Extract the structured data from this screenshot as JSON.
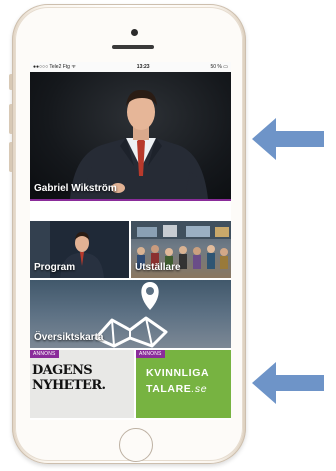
{
  "status_bar": {
    "carrier": "●●○○○ Tele2 Ftg ᯤ",
    "time": "13:23",
    "battery": "50 % ▭"
  },
  "hero": {
    "label": "Gabriel Wikström"
  },
  "tiles": {
    "program": "Program",
    "utstallare": "Utställare",
    "karta": "Översiktskarta"
  },
  "ads": {
    "tag": "ANNONS",
    "dn_line1": "DAGENS",
    "dn_line2": "NYHETER.",
    "kt_line1": "KVINNLIGA",
    "kt_line2_main": "TALARE",
    "kt_line2_suffix": ".se"
  },
  "colors": {
    "accent": "#8a2c9a",
    "arrow": "#6e94c8",
    "kvinnliga_bg": "#77b341"
  }
}
